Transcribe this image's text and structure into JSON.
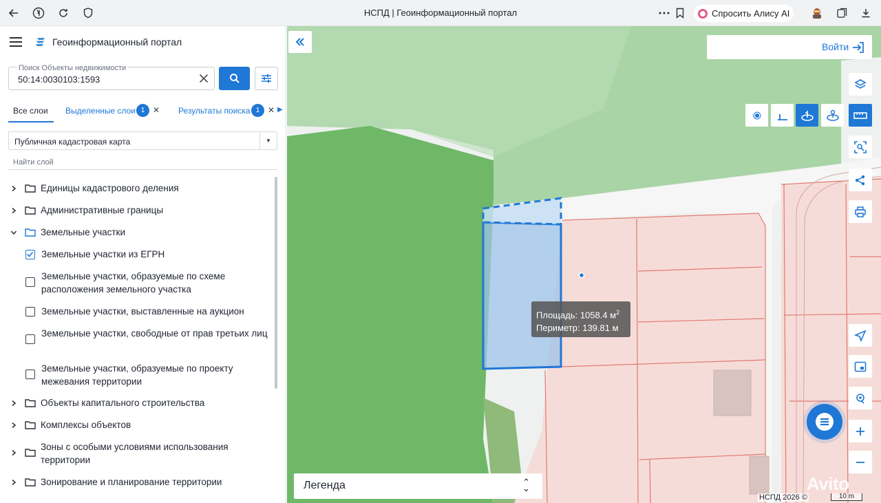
{
  "browser": {
    "title": "НСПД | Геоинформационный портал",
    "alice_label": "Спросить Алису AI"
  },
  "sidebar": {
    "app_title": "Геоинформационный портал",
    "search": {
      "label": "Поиск Объекты недвижимости",
      "value": "50:14:0030103:1593"
    },
    "tabs": [
      {
        "label": "Все слои"
      },
      {
        "label": "Выделенные слои",
        "count": "1"
      },
      {
        "label": "Результаты поиска",
        "count": "1"
      }
    ],
    "layer_select": "Публичная кадастровая карта",
    "find_layer_placeholder": "Найти слой",
    "tree": [
      {
        "label": "Единицы кадастрового деления"
      },
      {
        "label": "Административные границы"
      },
      {
        "label": "Земельные участки",
        "expanded": true
      },
      {
        "label": "Земельные участки из ЕГРН",
        "checked": true
      },
      {
        "label": "Земельные участки, образуемые по схеме расположения земельного участка",
        "checked": false
      },
      {
        "label": "Земельные участки, выставленные на аукцион",
        "checked": false
      },
      {
        "label": "Земельные участки, свободные от прав третьих лиц",
        "checked": false
      },
      {
        "label": "Земельные участки, образуемые по проекту межевания территории",
        "checked": false
      },
      {
        "label": "Объекты капитального строительства"
      },
      {
        "label": "Комплексы объектов"
      },
      {
        "label": "Зоны с особыми условиями использования территории"
      },
      {
        "label": "Зонирование и планирование территории"
      }
    ]
  },
  "map": {
    "login_label": "Войти",
    "tooltip": {
      "area_prefix": "Площадь: 1058.4 м",
      "area_sup": "2",
      "perimeter": "Периметр: 139.81 м"
    },
    "legend_label": "Легенда",
    "copyright": "НСПД 2026 ©",
    "scale_label": "10 m",
    "watermark": "Avito",
    "colors": {
      "accent": "#1f77d6",
      "forest": "#6fb868",
      "meadow": "#a9d4a6",
      "parcel_fill": "#f6dcd8",
      "parcel_stroke": "#e07a70"
    }
  }
}
